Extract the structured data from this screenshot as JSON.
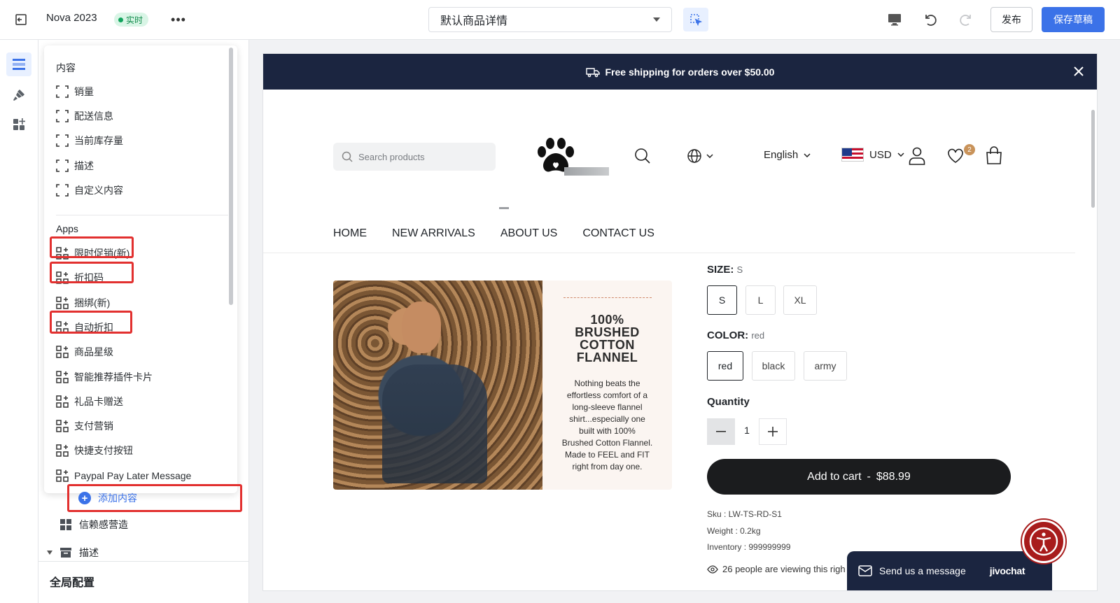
{
  "topbar": {
    "store_name": "Nova 2023",
    "live_label": "实时",
    "more_label": "•••",
    "page_select": "默认商品详情",
    "publish_label": "发布",
    "save_label": "保存草稿"
  },
  "sidebar": {
    "content_title": "内容",
    "content_items": [
      "销量",
      "配送信息",
      "当前库存量",
      "描述",
      "自定义内容"
    ],
    "apps_title": "Apps",
    "app_items": [
      "限时促销(新)",
      "折扣码",
      "捆绑(新)",
      "自动折扣",
      "商品星级",
      "智能推荐插件卡片",
      "礼品卡赠送",
      "支付营销",
      "快捷支付按钮",
      "Paypal Pay Later Message"
    ],
    "add_content": "添加内容",
    "tree_trust": "信赖感营造",
    "tree_desc": "描述",
    "global_config": "全局配置"
  },
  "preview": {
    "announcement": "Free shipping for orders over $50.00",
    "search_placeholder": "Search products",
    "language": "English",
    "currency": "USD",
    "wishlist_count": "2",
    "nav": [
      "HOME",
      "NEW ARRIVALS",
      "ABOUT US",
      "CONTACT US"
    ],
    "promo_heading": [
      "100%",
      "BRUSHED",
      "COTTON",
      "FLANNEL"
    ],
    "promo_text": [
      "Nothing beats the",
      "effortless comfort of a",
      "long-sleeve flannel",
      "shirt...especially one",
      "built with 100%",
      "Brushed Cotton Flannel.",
      "Made to FEEL and FIT",
      "right from day one."
    ],
    "size_label": "SIZE:",
    "size_value": "S",
    "sizes": [
      "S",
      "L",
      "XL"
    ],
    "color_label": "COLOR:",
    "color_value": "red",
    "colors": [
      "red",
      "black",
      "army"
    ],
    "quantity_label": "Quantity",
    "quantity_value": "1",
    "add_to_cart": "Add to cart",
    "price_sep": "-",
    "price": "$88.99",
    "sku": "Sku : LW-TS-RD-S1",
    "weight": "Weight : 0.2kg",
    "inventory": "Inventory : 999999999",
    "viewing": "26 people are viewing this righ",
    "chat_label": "Send us a message",
    "chat_brand": "jivochat"
  },
  "colors": {
    "accent": "#3b72e8",
    "highlight": "#e2302f",
    "announcement_bg": "#1b2540",
    "live_green": "#11a45d"
  }
}
